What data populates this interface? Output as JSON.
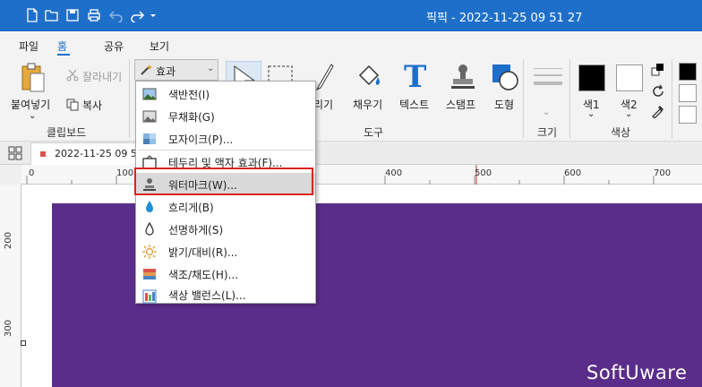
{
  "window": {
    "title": "픽픽 - 2022-11-25 09 51 27",
    "titlebar_icons": [
      "new-file-icon",
      "open-folder-icon",
      "save-icon",
      "print-icon",
      "undo-icon",
      "redo-icon",
      "quick-access-dropdown-icon"
    ]
  },
  "menu": {
    "tabs": [
      {
        "label": "파일",
        "active": false
      },
      {
        "label": "홈",
        "active": true
      },
      {
        "label": "공유",
        "active": false
      },
      {
        "label": "보기",
        "active": false
      }
    ]
  },
  "ribbon": {
    "clipboard": {
      "paste_label": "붙여넣기",
      "cut_label": "잘라내기",
      "copy_label": "복사",
      "group_label": "클립보드"
    },
    "effects_label": "효과",
    "tools": {
      "items": [
        "리기",
        "채우기",
        "텍스트",
        "스탬프",
        "도형"
      ],
      "group_label": "도구"
    },
    "size": {
      "group_label": "크기"
    },
    "color": {
      "color1_label": "색1",
      "color2_label": "색2",
      "group_label": "색상",
      "color1": "#000000",
      "color2": "#ffffff"
    }
  },
  "document": {
    "tab_label": "2022-11-25 09 51"
  },
  "rulers": {
    "top": [
      "0",
      "100",
      "400",
      "500",
      "600",
      "700"
    ],
    "left": [
      "200",
      "300"
    ]
  },
  "effects_menu": {
    "items": [
      {
        "label": "색반전(I)",
        "icon": "invert-icon"
      },
      {
        "label": "무채화(G)",
        "icon": "grayscale-icon"
      },
      {
        "label": "모자이크(P)...",
        "icon": "mosaic-icon"
      },
      {
        "label": "테두리 및 액자 효과(F)...",
        "icon": "frame-icon"
      },
      {
        "label": "워터마크(W)...",
        "icon": "watermark-icon",
        "highlighted": true
      },
      {
        "label": "흐리게(B)",
        "icon": "blur-icon"
      },
      {
        "label": "선명하게(S)",
        "icon": "sharpen-icon"
      },
      {
        "label": "밝기/대비(R)...",
        "icon": "brightness-icon"
      },
      {
        "label": "색조/채도(H)...",
        "icon": "hue-saturation-icon"
      },
      {
        "label": "색상 밸런스(L)...",
        "icon": "color-balance-icon"
      }
    ]
  },
  "canvas": {
    "background_color": "#5b2d8a",
    "watermark_text": "SoftUware"
  },
  "colors": {
    "titlebar": "#1e6fc9",
    "highlight_border": "#d9251d"
  }
}
